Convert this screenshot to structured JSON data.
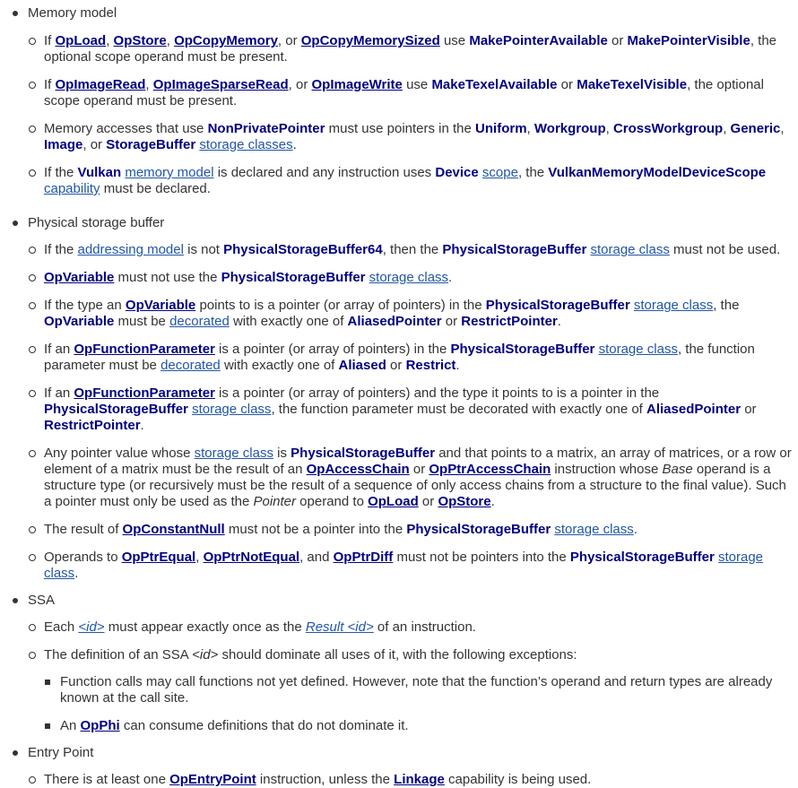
{
  "sections": [
    {
      "title": "Memory model",
      "items": [
        [
          [
            "t",
            "If "
          ],
          [
            "kl",
            "OpLoad"
          ],
          [
            "t",
            ", "
          ],
          [
            "kl",
            "OpStore"
          ],
          [
            "t",
            ", "
          ],
          [
            "kl",
            "OpCopyMemory"
          ],
          [
            "t",
            ", or "
          ],
          [
            "kl",
            "OpCopyMemorySized"
          ],
          [
            "t",
            " use "
          ],
          [
            "b",
            "MakePointerAvailable"
          ],
          [
            "t",
            " or "
          ],
          [
            "b",
            "MakePointerVisible"
          ],
          [
            "t",
            ", the optional scope operand must be present."
          ]
        ],
        [
          [
            "t",
            "If "
          ],
          [
            "kl",
            "OpImageRead"
          ],
          [
            "t",
            ", "
          ],
          [
            "kl",
            "OpImageSparseRead"
          ],
          [
            "t",
            ", or "
          ],
          [
            "kl",
            "OpImageWrite"
          ],
          [
            "t",
            " use "
          ],
          [
            "b",
            "MakeTexelAvailable"
          ],
          [
            "t",
            " or "
          ],
          [
            "b",
            "MakeTexelVisible"
          ],
          [
            "t",
            ", the optional scope operand must be present."
          ]
        ],
        [
          [
            "t",
            "Memory accesses that use "
          ],
          [
            "b",
            "NonPrivatePointer"
          ],
          [
            "t",
            " must use pointers in the "
          ],
          [
            "b",
            "Uniform"
          ],
          [
            "t",
            ", "
          ],
          [
            "b",
            "Workgroup"
          ],
          [
            "t",
            ", "
          ],
          [
            "b",
            "CrossWorkgroup"
          ],
          [
            "t",
            ", "
          ],
          [
            "b",
            "Generic"
          ],
          [
            "t",
            ", "
          ],
          [
            "b",
            "Image"
          ],
          [
            "t",
            ", or "
          ],
          [
            "b",
            "StorageBuffer"
          ],
          [
            "t",
            " "
          ],
          [
            "l",
            "storage classes"
          ],
          [
            "t",
            "."
          ]
        ],
        [
          [
            "t",
            "If the "
          ],
          [
            "b",
            "Vulkan"
          ],
          [
            "t",
            " "
          ],
          [
            "l",
            "memory model"
          ],
          [
            "t",
            " is declared and any instruction uses "
          ],
          [
            "b",
            "Device"
          ],
          [
            "t",
            " "
          ],
          [
            "l",
            "scope"
          ],
          [
            "t",
            ", the "
          ],
          [
            "b",
            "VulkanMemoryModelDeviceScope"
          ],
          [
            "t",
            " "
          ],
          [
            "l",
            "capability"
          ],
          [
            "t",
            " must be declared."
          ]
        ]
      ]
    },
    {
      "title": "Physical storage buffer",
      "items": [
        [
          [
            "t",
            "If the "
          ],
          [
            "l",
            "addressing model"
          ],
          [
            "t",
            " is not "
          ],
          [
            "b",
            "PhysicalStorageBuffer64"
          ],
          [
            "t",
            ", then the "
          ],
          [
            "b",
            "PhysicalStorageBuffer"
          ],
          [
            "t",
            " "
          ],
          [
            "l",
            "storage class"
          ],
          [
            "t",
            " must not be used."
          ]
        ],
        [
          [
            "kl",
            "OpVariable"
          ],
          [
            "t",
            " must not use the "
          ],
          [
            "b",
            "PhysicalStorageBuffer"
          ],
          [
            "t",
            " "
          ],
          [
            "l",
            "storage class"
          ],
          [
            "t",
            "."
          ]
        ],
        [
          [
            "t",
            "If the type an "
          ],
          [
            "kl",
            "OpVariable"
          ],
          [
            "t",
            " points to is a pointer (or array of pointers) in the "
          ],
          [
            "b",
            "PhysicalStorageBuffer"
          ],
          [
            "t",
            " "
          ],
          [
            "l",
            "storage class"
          ],
          [
            "t",
            ", the "
          ],
          [
            "b",
            "OpVariable"
          ],
          [
            "t",
            " must be "
          ],
          [
            "l",
            "decorated"
          ],
          [
            "t",
            " with exactly one of "
          ],
          [
            "b",
            "AliasedPointer"
          ],
          [
            "t",
            " or "
          ],
          [
            "b",
            "RestrictPointer"
          ],
          [
            "t",
            "."
          ]
        ],
        [
          [
            "t",
            "If an "
          ],
          [
            "kl",
            "OpFunctionParameter"
          ],
          [
            "t",
            " is a pointer (or array of pointers) in the "
          ],
          [
            "b",
            "PhysicalStorageBuffer"
          ],
          [
            "t",
            " "
          ],
          [
            "l",
            "storage class"
          ],
          [
            "t",
            ", the function parameter must be "
          ],
          [
            "l",
            "decorated"
          ],
          [
            "t",
            " with exactly one of "
          ],
          [
            "b",
            "Aliased"
          ],
          [
            "t",
            " or "
          ],
          [
            "b",
            "Restrict"
          ],
          [
            "t",
            "."
          ]
        ],
        [
          [
            "t",
            "If an "
          ],
          [
            "kl",
            "OpFunctionParameter"
          ],
          [
            "t",
            " is a pointer (or array of pointers) and the type it points to is a pointer in the "
          ],
          [
            "b",
            "PhysicalStorageBuffer"
          ],
          [
            "t",
            " "
          ],
          [
            "l",
            "storage class"
          ],
          [
            "t",
            ", the function parameter must be decorated with exactly one of "
          ],
          [
            "b",
            "AliasedPointer"
          ],
          [
            "t",
            " or "
          ],
          [
            "b",
            "RestrictPointer"
          ],
          [
            "t",
            "."
          ]
        ],
        [
          [
            "t",
            "Any pointer value whose "
          ],
          [
            "l",
            "storage class"
          ],
          [
            "t",
            " is "
          ],
          [
            "b",
            "PhysicalStorageBuffer"
          ],
          [
            "t",
            " and that points to a matrix, an array of matrices, or a row or element of a matrix must be the result of an "
          ],
          [
            "kl",
            "OpAccessChain"
          ],
          [
            "t",
            " or "
          ],
          [
            "kl",
            "OpPtrAccessChain"
          ],
          [
            "t",
            " instruction whose "
          ],
          [
            "i",
            "Base"
          ],
          [
            "t",
            " operand is a structure type (or recursively must be the result of a sequence of only access chains from a structure to the final value). Such a pointer must only be used as the "
          ],
          [
            "i",
            "Pointer"
          ],
          [
            "t",
            " operand to "
          ],
          [
            "kl",
            "OpLoad"
          ],
          [
            "t",
            " or "
          ],
          [
            "kl",
            "OpStore"
          ],
          [
            "t",
            "."
          ]
        ],
        [
          [
            "t",
            "The result of "
          ],
          [
            "kl",
            "OpConstantNull"
          ],
          [
            "t",
            " must not be a pointer into the "
          ],
          [
            "b",
            "PhysicalStorageBuffer"
          ],
          [
            "t",
            " "
          ],
          [
            "l",
            "storage class"
          ],
          [
            "t",
            "."
          ]
        ],
        [
          [
            "t",
            "Operands to "
          ],
          [
            "kl",
            "OpPtrEqual"
          ],
          [
            "t",
            ", "
          ],
          [
            "kl",
            "OpPtrNotEqual"
          ],
          [
            "t",
            ", and "
          ],
          [
            "kl",
            "OpPtrDiff"
          ],
          [
            "t",
            " must not be pointers into the "
          ],
          [
            "b",
            "PhysicalStorageBuffer"
          ],
          [
            "t",
            " "
          ],
          [
            "l",
            "storage class"
          ],
          [
            "t",
            "."
          ]
        ]
      ]
    },
    {
      "title": "SSA",
      "items": [
        [
          [
            "t",
            "Each "
          ],
          [
            "il",
            "<id>"
          ],
          [
            "t",
            " must appear exactly once as the "
          ],
          [
            "il",
            "Result <id>"
          ],
          [
            "t",
            " of an instruction."
          ]
        ],
        [
          [
            "t",
            "The definition of an SSA "
          ],
          [
            "i",
            "<id>"
          ],
          [
            "t",
            " should dominate all uses of it, with the following exceptions:"
          ]
        ]
      ],
      "subitems": [
        [
          [
            "t",
            "Function calls may call functions not yet defined. However, note that the function’s operand and return types are already known at the call site."
          ]
        ],
        [
          [
            "t",
            "An "
          ],
          [
            "kl",
            "OpPhi"
          ],
          [
            "t",
            " can consume definitions that do not dominate it."
          ]
        ]
      ]
    },
    {
      "title": "Entry Point",
      "items": [
        [
          [
            "t",
            "There is at least one "
          ],
          [
            "kl",
            "OpEntryPoint"
          ],
          [
            "t",
            " instruction, unless the "
          ],
          [
            "kl",
            "Linkage"
          ],
          [
            "t",
            " capability is being used."
          ]
        ]
      ]
    }
  ]
}
